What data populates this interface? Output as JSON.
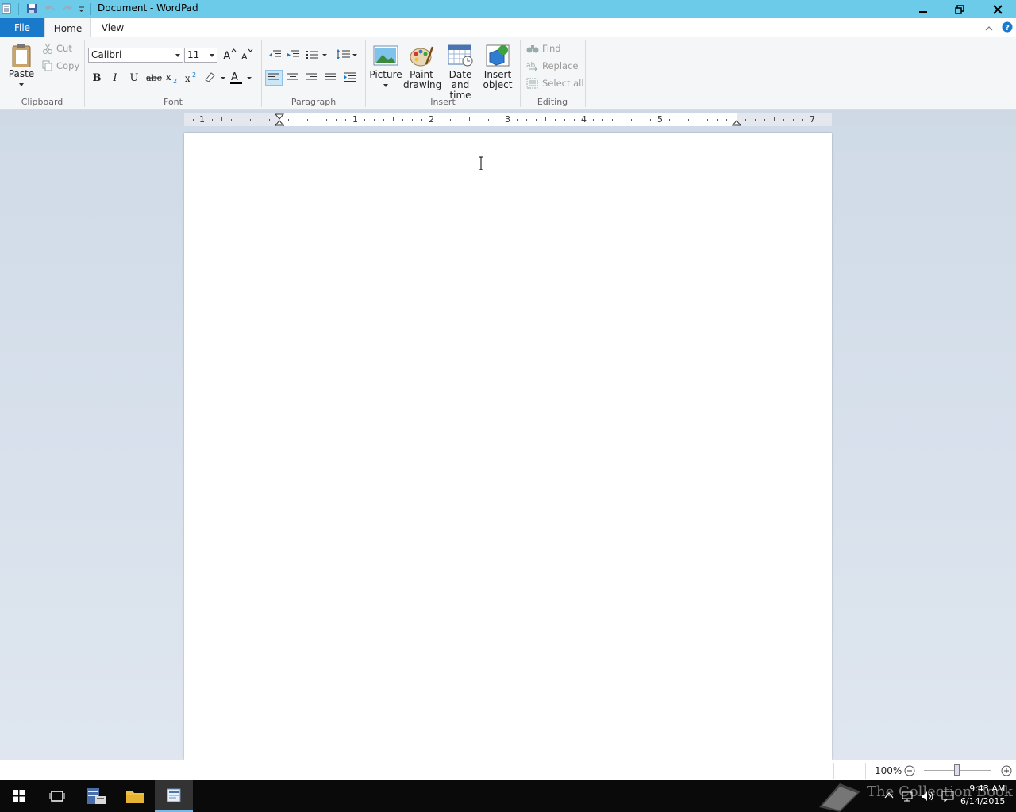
{
  "window": {
    "title": "Document - WordPad",
    "accent_color": "#6bcbe8"
  },
  "tabs": {
    "file": "File",
    "home": "Home",
    "view": "View"
  },
  "clipboard": {
    "paste": "Paste",
    "cut": "Cut",
    "copy": "Copy",
    "label": "Clipboard"
  },
  "font": {
    "family": "Calibri",
    "size": "11",
    "label": "Font"
  },
  "paragraph": {
    "label": "Paragraph"
  },
  "insert": {
    "picture": "Picture",
    "paint_1": "Paint",
    "paint_2": "drawing",
    "datetime_1": "Date and",
    "datetime_2": "time",
    "object_1": "Insert",
    "object_2": "object",
    "label": "Insert"
  },
  "editing": {
    "find": "Find",
    "replace": "Replace",
    "select_all": "Select all",
    "label": "Editing"
  },
  "ruler": {
    "numbers": [
      "1",
      "1",
      "2",
      "3",
      "4",
      "5",
      "7"
    ]
  },
  "status": {
    "zoom": "100%"
  },
  "taskbar": {
    "time": "9:43 AM",
    "date": "6/14/2015",
    "watermark": "The Collection Book"
  }
}
